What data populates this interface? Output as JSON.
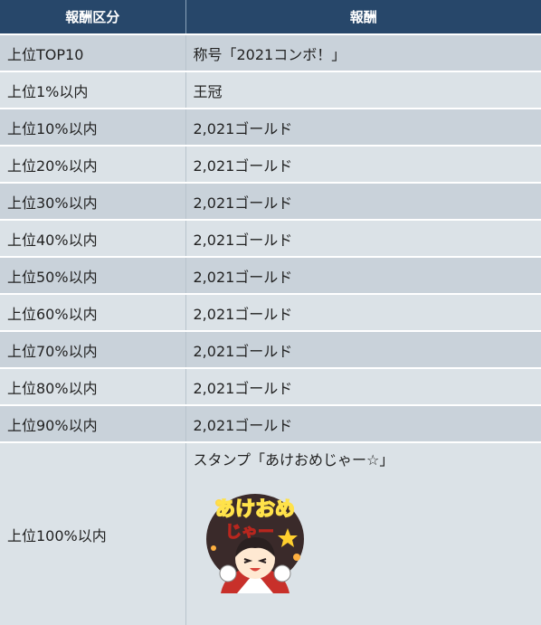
{
  "header": {
    "col1": "報酬区分",
    "col2": "報酬"
  },
  "rows": [
    {
      "tier": "上位TOP10",
      "reward": "称号「2021コンボ！」"
    },
    {
      "tier": "上位1%以内",
      "reward": "王冠"
    },
    {
      "tier": "上位10%以内",
      "reward": "2,021ゴールド"
    },
    {
      "tier": "上位20%以内",
      "reward": "2,021ゴールド"
    },
    {
      "tier": "上位30%以内",
      "reward": "2,021ゴールド"
    },
    {
      "tier": "上位40%以内",
      "reward": "2,021ゴールド"
    },
    {
      "tier": "上位50%以内",
      "reward": "2,021ゴールド"
    },
    {
      "tier": "上位60%以内",
      "reward": "2,021ゴールド"
    },
    {
      "tier": "上位70%以内",
      "reward": "2,021ゴールド"
    },
    {
      "tier": "上位80%以内",
      "reward": "2,021ゴールド"
    },
    {
      "tier": "上位90%以内",
      "reward": "2,021ゴールド"
    },
    {
      "tier": "上位100%以内",
      "reward": "スタンプ「あけおめじゃー☆」"
    }
  ],
  "stamp_image": {
    "lettering": "あけおめじゃー"
  },
  "colors": {
    "header_bg": "#27476a",
    "row_dark": "#c9d2da",
    "row_light": "#dbe2e7"
  }
}
